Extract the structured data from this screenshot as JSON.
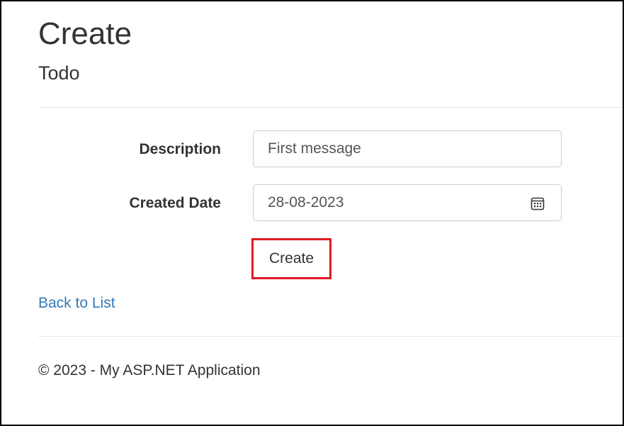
{
  "header": {
    "title": "Create",
    "subtitle": "Todo"
  },
  "form": {
    "description": {
      "label": "Description",
      "value": "First message"
    },
    "created_date": {
      "label": "Created Date",
      "value": "28-08-2023",
      "icon": "calendar-icon"
    },
    "submit_label": "Create",
    "highlight_color": "#e01b24"
  },
  "nav": {
    "back_link": "Back to List"
  },
  "footer": {
    "text": "© 2023 - My ASP.NET Application"
  },
  "colors": {
    "link": "#337ab7",
    "text": "#333333"
  }
}
